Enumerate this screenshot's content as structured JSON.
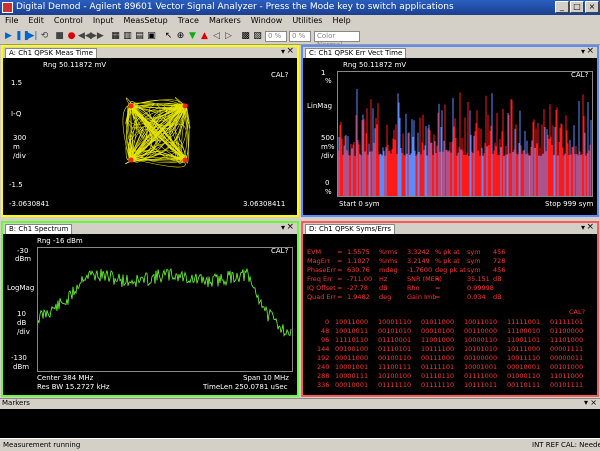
{
  "window": {
    "title": "Digital Demod - Agilent 89601 Vector Signal Analyzer - Press the Mode key to switch applications"
  },
  "menu": [
    "File",
    "Edit",
    "Control",
    "Input",
    "MeasSetup",
    "Trace",
    "Markers",
    "Window",
    "Utilities",
    "Help"
  ],
  "toolbar": {
    "pct_value": "0 %",
    "zoom_value": "0 %",
    "color_select": "Color Normal"
  },
  "pane_a": {
    "tab": "A: Ch1 QPSK Meas Time",
    "range": "Rng 50.11872 mV",
    "cal": "CAL?",
    "yaxis": "I-Q",
    "div_value": "300",
    "div_unit": "m",
    "div_per": "/div",
    "ytop": "1.5",
    "ybot": "-1.5",
    "xleft": "-3.0630841",
    "xright": "3.06308411"
  },
  "pane_b": {
    "tab": "B: Ch1 Spectrum",
    "range": "Rng -16 dBm",
    "cal": "CAL?",
    "ytop": "-30",
    "ytop_unit": "dBm",
    "yaxis": "LogMag",
    "div_value": "10",
    "div_unit": "dB",
    "div_per": "/div",
    "ybot": "-130",
    "ybot_unit": "dBm",
    "center": "Center 384 MHz",
    "span": "Span 10 MHz",
    "rbw": "Res BW 15.2727 kHz",
    "timelen": "TimeLen 250.0781 uSec"
  },
  "pane_c": {
    "tab": "C: Ch1 QPSK Err Vect Time",
    "range": "Rng 50.11872 mV",
    "cal": "CAL?",
    "ytop": "1",
    "ytop_unit": "%",
    "yaxis": "LinMag",
    "div_value": "500",
    "div_unit": "m%",
    "div_per": "/div",
    "ybot": "0",
    "ybot_unit": "%",
    "start": "Start 0  sym",
    "stop": "Stop 999  sym"
  },
  "pane_d": {
    "tab": "D: Ch1 QPSK Syms/Errs",
    "cal": "CAL?",
    "stats": [
      [
        "EVM",
        "=",
        "1.5575",
        "%rms",
        "3.3242",
        "% pk at",
        "sym",
        "456"
      ],
      [
        "MagErr",
        "=",
        "1.1027",
        "%rms",
        "3.2149",
        "% pk at",
        "sym",
        "728"
      ],
      [
        "PhaseErr",
        "=",
        "630.76",
        "mdeg",
        "-1.7600",
        "deg pk at",
        "sym",
        "456"
      ],
      [
        "Freq Err",
        "=",
        "-711.00",
        "Hz",
        "SNR (MER)",
        "=",
        "35.151",
        "dB"
      ],
      [
        "IQ Offset",
        "=",
        "-27.78",
        "dB",
        "Rho",
        "=",
        "0.99998",
        ""
      ],
      [
        "Quad Err",
        "=",
        "1.9482",
        "deg",
        "Gain Imb",
        "=",
        "0.034",
        "dB"
      ]
    ],
    "rows": [
      [
        "0",
        "10011000",
        "10001110",
        "01011000",
        "10011010",
        "11111001",
        "01111101"
      ],
      [
        "48",
        "10010011",
        "00101010",
        "00010100",
        "00110000",
        "11100010",
        "01100000"
      ],
      [
        "96",
        "11110110",
        "01110001",
        "11001000",
        "10000110",
        "11001101",
        "11101000"
      ],
      [
        "144",
        "00100100",
        "01110101",
        "10111100",
        "10101010",
        "10111000",
        "00001111"
      ],
      [
        "192",
        "00011000",
        "00100110",
        "00111000",
        "00100000",
        "10011110",
        "00000011"
      ],
      [
        "240",
        "10001001",
        "11100111",
        "01111101",
        "10001001",
        "00010001",
        "00101000"
      ],
      [
        "288",
        "10000111",
        "10100100",
        "01110110",
        "01111000",
        "01000110",
        "11011000"
      ],
      [
        "336",
        "00010001",
        "01111110",
        "01111110",
        "10111011",
        "00110111",
        "00101111"
      ]
    ]
  },
  "markers": {
    "label": "Markers"
  },
  "status": {
    "message": "Measurement running",
    "intref": "INT REF",
    "cal": "CAL: Needed"
  },
  "colors": {
    "pane_a": "#ffff00",
    "pane_b": "#66ff33",
    "pane_c": "#5b8cff",
    "pane_d": "#ff5a5a",
    "window_title": "#2a5fbf"
  }
}
